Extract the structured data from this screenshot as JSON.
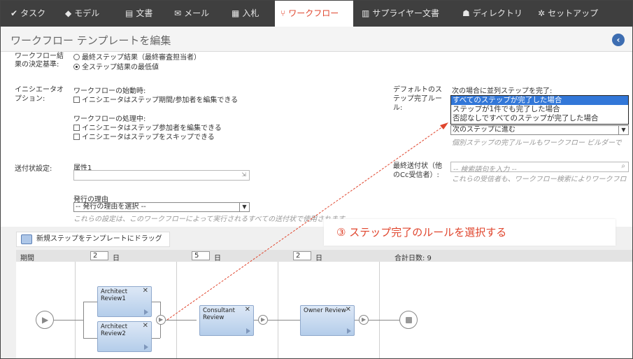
{
  "nav": {
    "items": [
      {
        "label": "タスク",
        "icon": "check-icon"
      },
      {
        "label": "モデル",
        "icon": "cube-icon"
      },
      {
        "label": "文書",
        "icon": "document-icon"
      },
      {
        "label": "メール",
        "icon": "mail-icon"
      },
      {
        "label": "入札",
        "icon": "bid-icon"
      },
      {
        "label": "ワークフロー",
        "icon": "workflow-icon",
        "active": true
      },
      {
        "label": "サプライヤー文書",
        "icon": "supplier-doc-icon"
      },
      {
        "label": "ディレクトリ",
        "icon": "directory-icon"
      },
      {
        "label": "セットアップ",
        "icon": "gear-icon"
      }
    ]
  },
  "header": {
    "title": "ワークフロー テンプレートを編集",
    "back_icon": "back-arrow-icon"
  },
  "form": {
    "result_label": "ワークフロー結果の決定基準:",
    "result_opt1": "最終ステップ結果（最終審査担当者）",
    "result_opt2": "全ステップ結果の最低値",
    "initiator_label": "イニシエータオプション:",
    "on_start": "ワークフローの始動時:",
    "on_start_opt1": "イニシエータはステップ期間/参加者を編集できる",
    "in_progress": "ワークフローの処理中:",
    "in_progress_opt1": "イニシエータはステップ参加者を編集できる",
    "in_progress_opt2": "イニシエータはステップをスキップできる",
    "default_rule_label": "デフォルトのステップ完了ルール:",
    "parallel_label": "次の場合に並列ステップを完了:",
    "parallel_options": [
      "すべてのステップが完了した場合",
      "ステップが1件でも完了した場合",
      "否認なしですべてのステップが完了した場合"
    ],
    "next_step_select": "次のステップに進む",
    "rule_note": "個別ステップの完了ルールもワークフロー ビルダーで",
    "transmittal_label": "送付状設定:",
    "attribute1_label": "属性1",
    "reason_label": "発行の理由",
    "reason_select": "-- 発行の理由を選択 --",
    "reason_note": "これらの設定は、このワークフローによって実行されるすべての送付状で使用されます。",
    "final_label": "最終送付状（他のCc受信者）:",
    "search_placeholder": "-- 検索語句を入力 --",
    "final_note": "これらの受信者も、ワークフロー検索によりワークフロ"
  },
  "annotation": "③ ステップ完了のルールを選択する",
  "builder": {
    "drag_label": "新規ステップをテンプレートにドラッグ",
    "duration_label": "期間",
    "durations": [
      "2",
      "5",
      "2"
    ],
    "day_unit": "日",
    "total_days": "合計日数: 9",
    "steps": [
      {
        "name": "Architect Review1"
      },
      {
        "name": "Architect Review2"
      },
      {
        "name": "Consultant Review"
      },
      {
        "name": "Owner Review"
      }
    ]
  },
  "colors": {
    "accent": "#e0452d",
    "nav_bg": "#3f3f3f",
    "selection": "#3277d8",
    "step": "#b4cdea"
  }
}
